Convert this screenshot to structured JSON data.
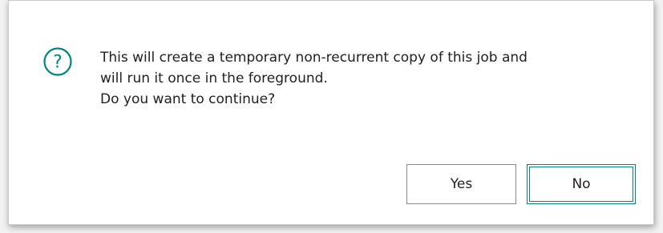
{
  "dialog": {
    "icon": "question-circle-icon",
    "accent_color": "#00857f",
    "message_lines": [
      "This will create a temporary non-recurrent copy of this job and",
      "will run it once in the foreground.",
      "Do you want to continue?"
    ],
    "buttons": {
      "yes_label": "Yes",
      "no_label": "No"
    }
  }
}
